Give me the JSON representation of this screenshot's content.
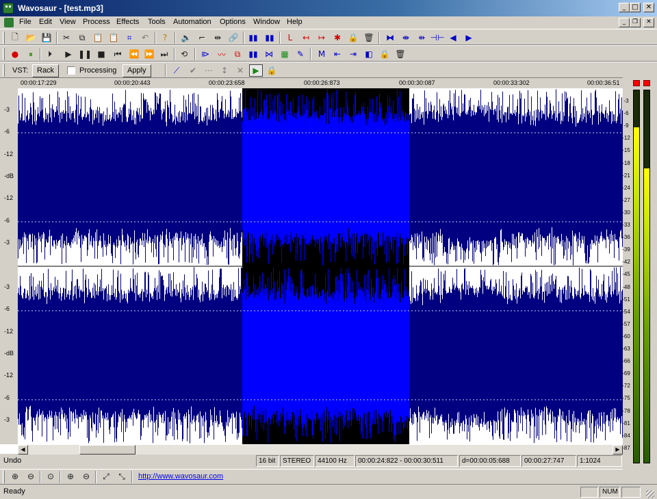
{
  "window": {
    "title": "Wavosaur - [test.mp3]"
  },
  "menu": [
    "File",
    "Edit",
    "View",
    "Process",
    "Effects",
    "Tools",
    "Automation",
    "Options",
    "Window",
    "Help"
  ],
  "vst_bar": {
    "label": "VST:",
    "rack": "Rack",
    "processing": "Processing",
    "apply": "Apply"
  },
  "ruler": [
    "00:00:17:229",
    "00:00:20:443",
    "00:00:23:658",
    "00:00:26:873",
    "00:00:30:087",
    "00:00:33:302",
    "00:00:36:51"
  ],
  "db_labels": [
    "-3",
    "-6",
    "-12",
    "-dB",
    "-12",
    "-6",
    "-3"
  ],
  "meter_scale": [
    "-3",
    "-6",
    "-9",
    "-12",
    "-15",
    "-18",
    "-21",
    "-24",
    "-27",
    "-30",
    "-33",
    "-36",
    "-39",
    "-42",
    "-45",
    "-48",
    "-51",
    "-54",
    "-57",
    "-60",
    "-63",
    "-66",
    "-69",
    "-72",
    "-75",
    "-78",
    "-81",
    "-84",
    "-87"
  ],
  "meter_levels": {
    "left": 0.9,
    "right": 0.79
  },
  "selection": {
    "start": "00:00:24:822",
    "end": "00:00:30:511"
  },
  "status": {
    "undo": "Undo",
    "bits": "16 bit",
    "channels": "STEREO",
    "rate": "44100 Hz",
    "range": "00:00:24:822 - 00:00:30:511",
    "duration": "d=00:00:05:688",
    "cursor": "00:00:27:747",
    "zoom": "1:1024"
  },
  "link": "http://www.wavosaur.com",
  "statusbar": {
    "ready": "Ready",
    "num": "NUM"
  },
  "colors": {
    "wave": "#000080",
    "selection_bg": "#000000",
    "selection_wave": "#0000ff",
    "title_start": "#0a246a"
  }
}
